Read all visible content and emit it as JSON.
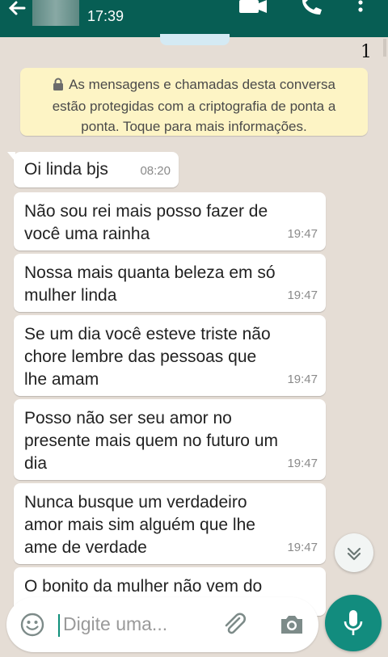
{
  "header": {
    "time": "17:39",
    "icons": [
      "back-arrow-icon",
      "video-call-icon",
      "phone-icon",
      "more-vertical-icon"
    ]
  },
  "page_marker": "1",
  "encryption_notice": {
    "line1": "As mensagens e chamadas desta conversa",
    "line2": "estão protegidas com a criptografia de ponta a",
    "line3": "ponta. Toque para mais informações."
  },
  "messages": [
    {
      "lines": [
        "Oi linda bjs"
      ],
      "time": "08:20"
    },
    {
      "lines": [
        "Não sou rei mais posso fazer de",
        "você uma rainha"
      ],
      "time": "19:47"
    },
    {
      "lines": [
        "Nossa mais quanta beleza em só",
        "mulher linda"
      ],
      "time": "19:47"
    },
    {
      "lines": [
        "Se um dia você esteve triste não",
        "chore lembre das pessoas que",
        "lhe amam"
      ],
      "time": "19:47"
    },
    {
      "lines": [
        "Posso não ser seu amor no",
        "presente mais quem no futuro um",
        "dia"
      ],
      "time": "19:47"
    },
    {
      "lines": [
        "Nunca busque um verdadeiro",
        "amor mais sim alguém que lhe",
        "ame de verdade"
      ],
      "time": "19:47"
    },
    {
      "lines": [
        "O bonito da mulher não vem do"
      ]
    }
  ],
  "composer": {
    "placeholder": "Digite uma..."
  },
  "colors": {
    "header": "#075e54",
    "background": "#e5ddd5",
    "notice": "#fdf4c5",
    "mic_button": "#128c7e"
  }
}
